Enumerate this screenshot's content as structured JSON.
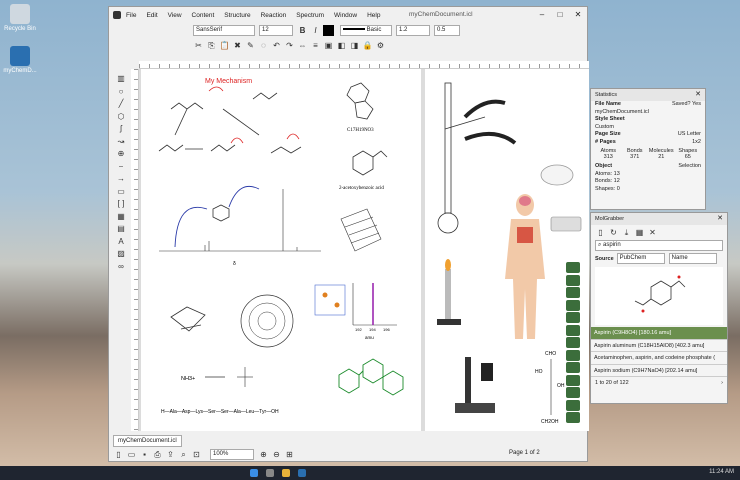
{
  "desktop": {
    "icons": [
      {
        "label": "Recycle Bin"
      },
      {
        "label": "myChemD..."
      }
    ],
    "clock": "11:24 AM"
  },
  "window": {
    "title": "myChemDocument.icl",
    "menu": [
      "File",
      "Edit",
      "View",
      "Content",
      "Structure",
      "Reaction",
      "Spectrum",
      "Window",
      "Help"
    ],
    "font": "SansSerif",
    "font_size": "12",
    "line_style": "Basic",
    "line_width": "1.2",
    "arrow_size": "0.5",
    "doc_tab": "myChemDocument.icl",
    "zoom": "100%",
    "page_info": "Page 1 of 2"
  },
  "canvas": {
    "mechanism_title": "My Mechanism",
    "formula": "C17H19NO3",
    "acid_name": "2-acetoxybenzoic acid",
    "axis_label": "δ",
    "ms_label": "amu",
    "ms_ticks": [
      "192",
      "194",
      "196"
    ],
    "ammonia": "NH3+",
    "peptide": "H—Ala—Asp—Lys—Ser—Ser—Ala—Leu—Tyr—OH",
    "sugar_labels": [
      "CHO",
      "HO",
      "OH",
      "CH2OH"
    ]
  },
  "statistics": {
    "title": "Statistics",
    "file_name_label": "File Name",
    "file_name": "myChemDocument.icl",
    "saved_label": "Saved? Yes",
    "style_sheet_label": "Style Sheet",
    "style_sheet": "Custom",
    "page_size_label": "Page Size",
    "page_size": "US Letter",
    "pages_label": "# Pages",
    "pages": "1x2",
    "counts_headers": [
      "Atoms",
      "Bonds",
      "Molecules",
      "Shapes"
    ],
    "counts": [
      "313",
      "371",
      "21",
      "65"
    ],
    "object_label": "Object",
    "selection_label": "Selection",
    "atoms": "Atoms: 13",
    "bonds": "Bonds: 12",
    "shapes": "Shapes: 0"
  },
  "molgrabber": {
    "title": "MolGrabber",
    "search_value": "aspirin",
    "source_label": "Source",
    "source": "PubChem",
    "field": "Name",
    "results": [
      "Aspirin (C9H8O4) [180.16 amu]",
      "Aspirin aluminum (C18H15AlO8) [402.3 amu]",
      "Acetaminophen, aspirin, and codeine phosphate (",
      "Aspirin sodium (C9H7NaO4) [202.14 amu]"
    ],
    "paging": "1 to 20 of 122"
  }
}
